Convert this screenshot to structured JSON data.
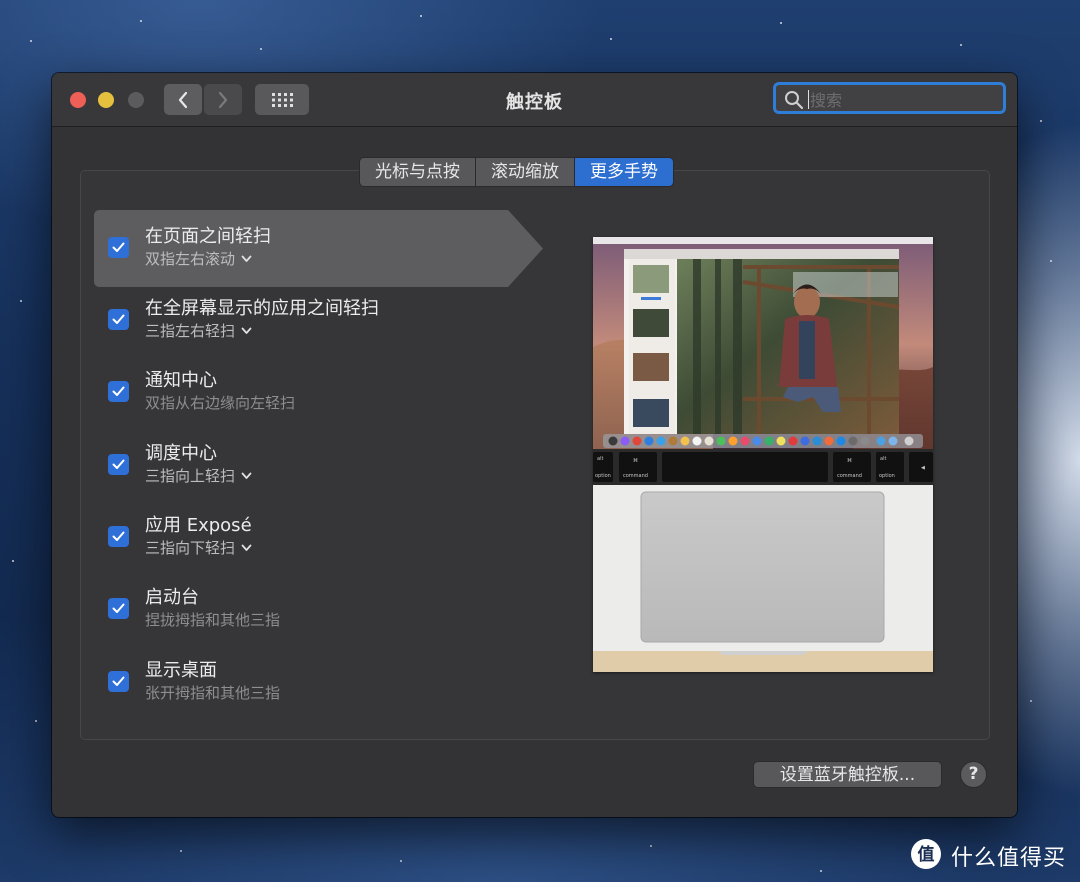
{
  "window": {
    "title": "触控板",
    "search_placeholder": "搜索"
  },
  "tabs": [
    {
      "label": "光标与点按",
      "active": false
    },
    {
      "label": "滚动缩放",
      "active": false
    },
    {
      "label": "更多手势",
      "active": true
    }
  ],
  "gestures": [
    {
      "title": "在页面之间轻扫",
      "subtitle": "双指左右滚动",
      "checked": true,
      "has_dropdown": true,
      "selected": true
    },
    {
      "title": "在全屏幕显示的应用之间轻扫",
      "subtitle": "三指左右轻扫",
      "checked": true,
      "has_dropdown": true,
      "selected": false
    },
    {
      "title": "通知中心",
      "subtitle": "双指从右边缘向左轻扫",
      "checked": true,
      "has_dropdown": false,
      "selected": false
    },
    {
      "title": "调度中心",
      "subtitle": "三指向上轻扫",
      "checked": true,
      "has_dropdown": true,
      "selected": false
    },
    {
      "title": "应用 Exposé",
      "subtitle": "三指向下轻扫",
      "checked": true,
      "has_dropdown": true,
      "selected": false
    },
    {
      "title": "启动台",
      "subtitle": "捏拢拇指和其他三指",
      "checked": true,
      "has_dropdown": false,
      "selected": false
    },
    {
      "title": "显示桌面",
      "subtitle": "张开拇指和其他三指",
      "checked": true,
      "has_dropdown": false,
      "selected": false
    }
  ],
  "preview": {
    "keys": [
      "option",
      "command",
      "command",
      "option"
    ],
    "key_symbols": [
      "alt",
      "⌘",
      "⌘",
      "alt"
    ]
  },
  "buttons": {
    "bluetooth": "设置蓝牙触控板...",
    "help": "?"
  },
  "watermark": {
    "text": "什么值得买",
    "logo_char": "值"
  },
  "colors": {
    "accent": "#2d6ed1",
    "close": "#ee5f57",
    "minimize": "#e5c03f",
    "window_bg": "#333336"
  }
}
